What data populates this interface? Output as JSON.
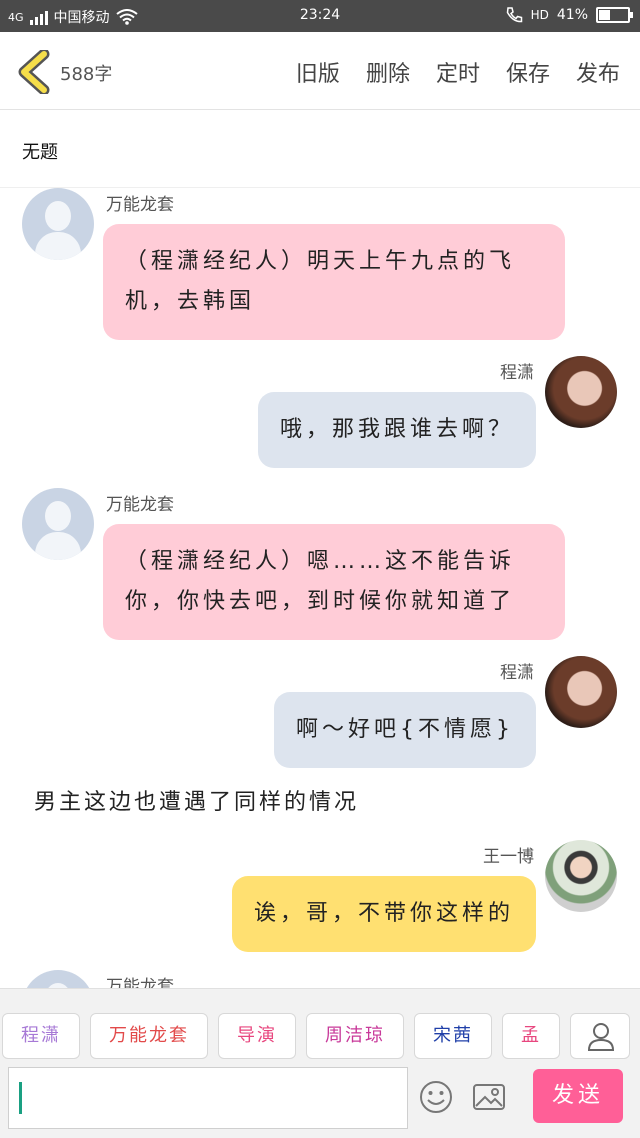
{
  "status_bar": {
    "network": "4G",
    "carrier": "中国移动",
    "time": "23:24",
    "hd": "HD",
    "battery": "41%",
    "battery_level": 0.41
  },
  "header": {
    "word_count": "588字",
    "actions": [
      "旧版",
      "删除",
      "定时",
      "保存",
      "发布"
    ]
  },
  "document": {
    "title": "无题"
  },
  "messages": [
    {
      "speaker": "万能龙套",
      "side": "left",
      "text": "（程潇经纪人）明天上午九点的飞机，去韩国",
      "bubble_color": "#ffccd7"
    },
    {
      "speaker": "程潇",
      "side": "right",
      "text": "哦，那我跟谁去啊？",
      "bubble_color": "#dde4ee"
    },
    {
      "speaker": "万能龙套",
      "side": "left",
      "text": "（程潇经纪人）嗯……这不能告诉你，你快去吧，到时候你就知道了",
      "bubble_color": "#ffccd7"
    },
    {
      "speaker": "程潇",
      "side": "right",
      "text": "啊～好吧{不情愿}",
      "bubble_color": "#dde4ee"
    },
    {
      "narration": "男主这边也遭遇了同样的情况"
    },
    {
      "speaker": "王一博",
      "side": "right",
      "text": "诶，哥，不带你这样的",
      "bubble_color": "#ffe071"
    },
    {
      "speaker": "万能龙套",
      "side": "left"
    }
  ],
  "characters": [
    {
      "name": "程潇",
      "color": "#a779d6"
    },
    {
      "name": "万能龙套",
      "color": "#e24a4a"
    },
    {
      "name": "导演",
      "color": "#e8477f"
    },
    {
      "name": "周洁琼",
      "color": "#c8399a"
    },
    {
      "name": "宋茜",
      "color": "#1f3fa8"
    },
    {
      "name": "孟",
      "color": "#e8477f"
    }
  ],
  "composer": {
    "input_value": "",
    "send_label": "发送",
    "send_color": "#ff5f97"
  },
  "icons": [
    "back-chevron-icon",
    "emoji-icon",
    "image-icon",
    "add-character-icon"
  ]
}
